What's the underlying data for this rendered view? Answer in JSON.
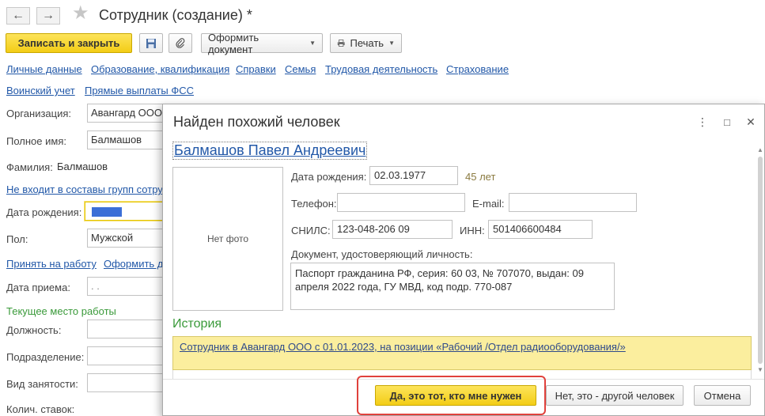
{
  "window": {
    "title": "Сотрудник (создание) *",
    "back_icon": "←",
    "forward_icon": "→",
    "favorite_icon": "★"
  },
  "toolbar": {
    "save_close": "Записать и закрыть",
    "create_document": "Оформить документ",
    "print": "Печать"
  },
  "nav_links": {
    "row1": [
      "Личные данные",
      "Образование, квалификация",
      "Справки",
      "Семья",
      "Трудовая деятельность",
      "Страхование"
    ],
    "row2": [
      "Воинский учет",
      "Прямые выплаты ФСС"
    ]
  },
  "form": {
    "organization_label": "Организация:",
    "organization_value": "Авангард ООО",
    "full_name_label": "Полное имя:",
    "full_name_value": "Балмашов",
    "surname_label": "Фамилия:",
    "surname_value": "Балмашов",
    "groups_link": "Не входит в составы групп сотру",
    "birth_date_label": "Дата рождения:",
    "gender_label": "Пол:",
    "gender_value": "Мужской",
    "hire_link": "Принять на работу",
    "issue_link": "Оформить д",
    "hire_date_label": "Дата приема:",
    "hire_date_value": ".  .",
    "current_job_label": "Текущее место работы",
    "position_label": "Должность:",
    "department_label": "Подразделение:",
    "employment_type_label": "Вид занятости:",
    "rates_label": "Колич. ставок:"
  },
  "modal": {
    "title": "Найден похожий человек",
    "more_icon": "⋮",
    "maximize_icon": "□",
    "close_icon": "✕",
    "person_name": "Балмашов Павел Андреевич",
    "no_photo": "Нет фото",
    "birth_date_label": "Дата рождения:",
    "birth_date_value": "02.03.1977",
    "age": "45 лет",
    "phone_label": "Телефон:",
    "phone_value": "",
    "email_label": "E-mail:",
    "email_value": "",
    "snils_label": "СНИЛС:",
    "snils_value": "123-048-206 09",
    "inn_label": "ИНН:",
    "inn_value": "501406600484",
    "document_label": "Документ, удостоверяющий личность:",
    "document_value": "Паспорт гражданина РФ, серия: 60 03, № 707070, выдан: 09 апреля 2022 года, ГУ МВД, код подр. 770-087",
    "history_title": "История",
    "history_item": "Сотрудник в Авангард ООО с 01.01.2023, на позиции «Рабочий /Отдел радиооборудования/»",
    "yes_button": "Да, это тот, кто мне нужен",
    "no_button": "Нет, это - другой человек",
    "cancel_button": "Отмена"
  },
  "colors": {
    "accent_yellow": "#f3cd16",
    "link_blue": "#2258a8",
    "history_green": "#3a9a3a",
    "highlight_red": "#e0413c",
    "history_bg": "#fbee9e"
  }
}
